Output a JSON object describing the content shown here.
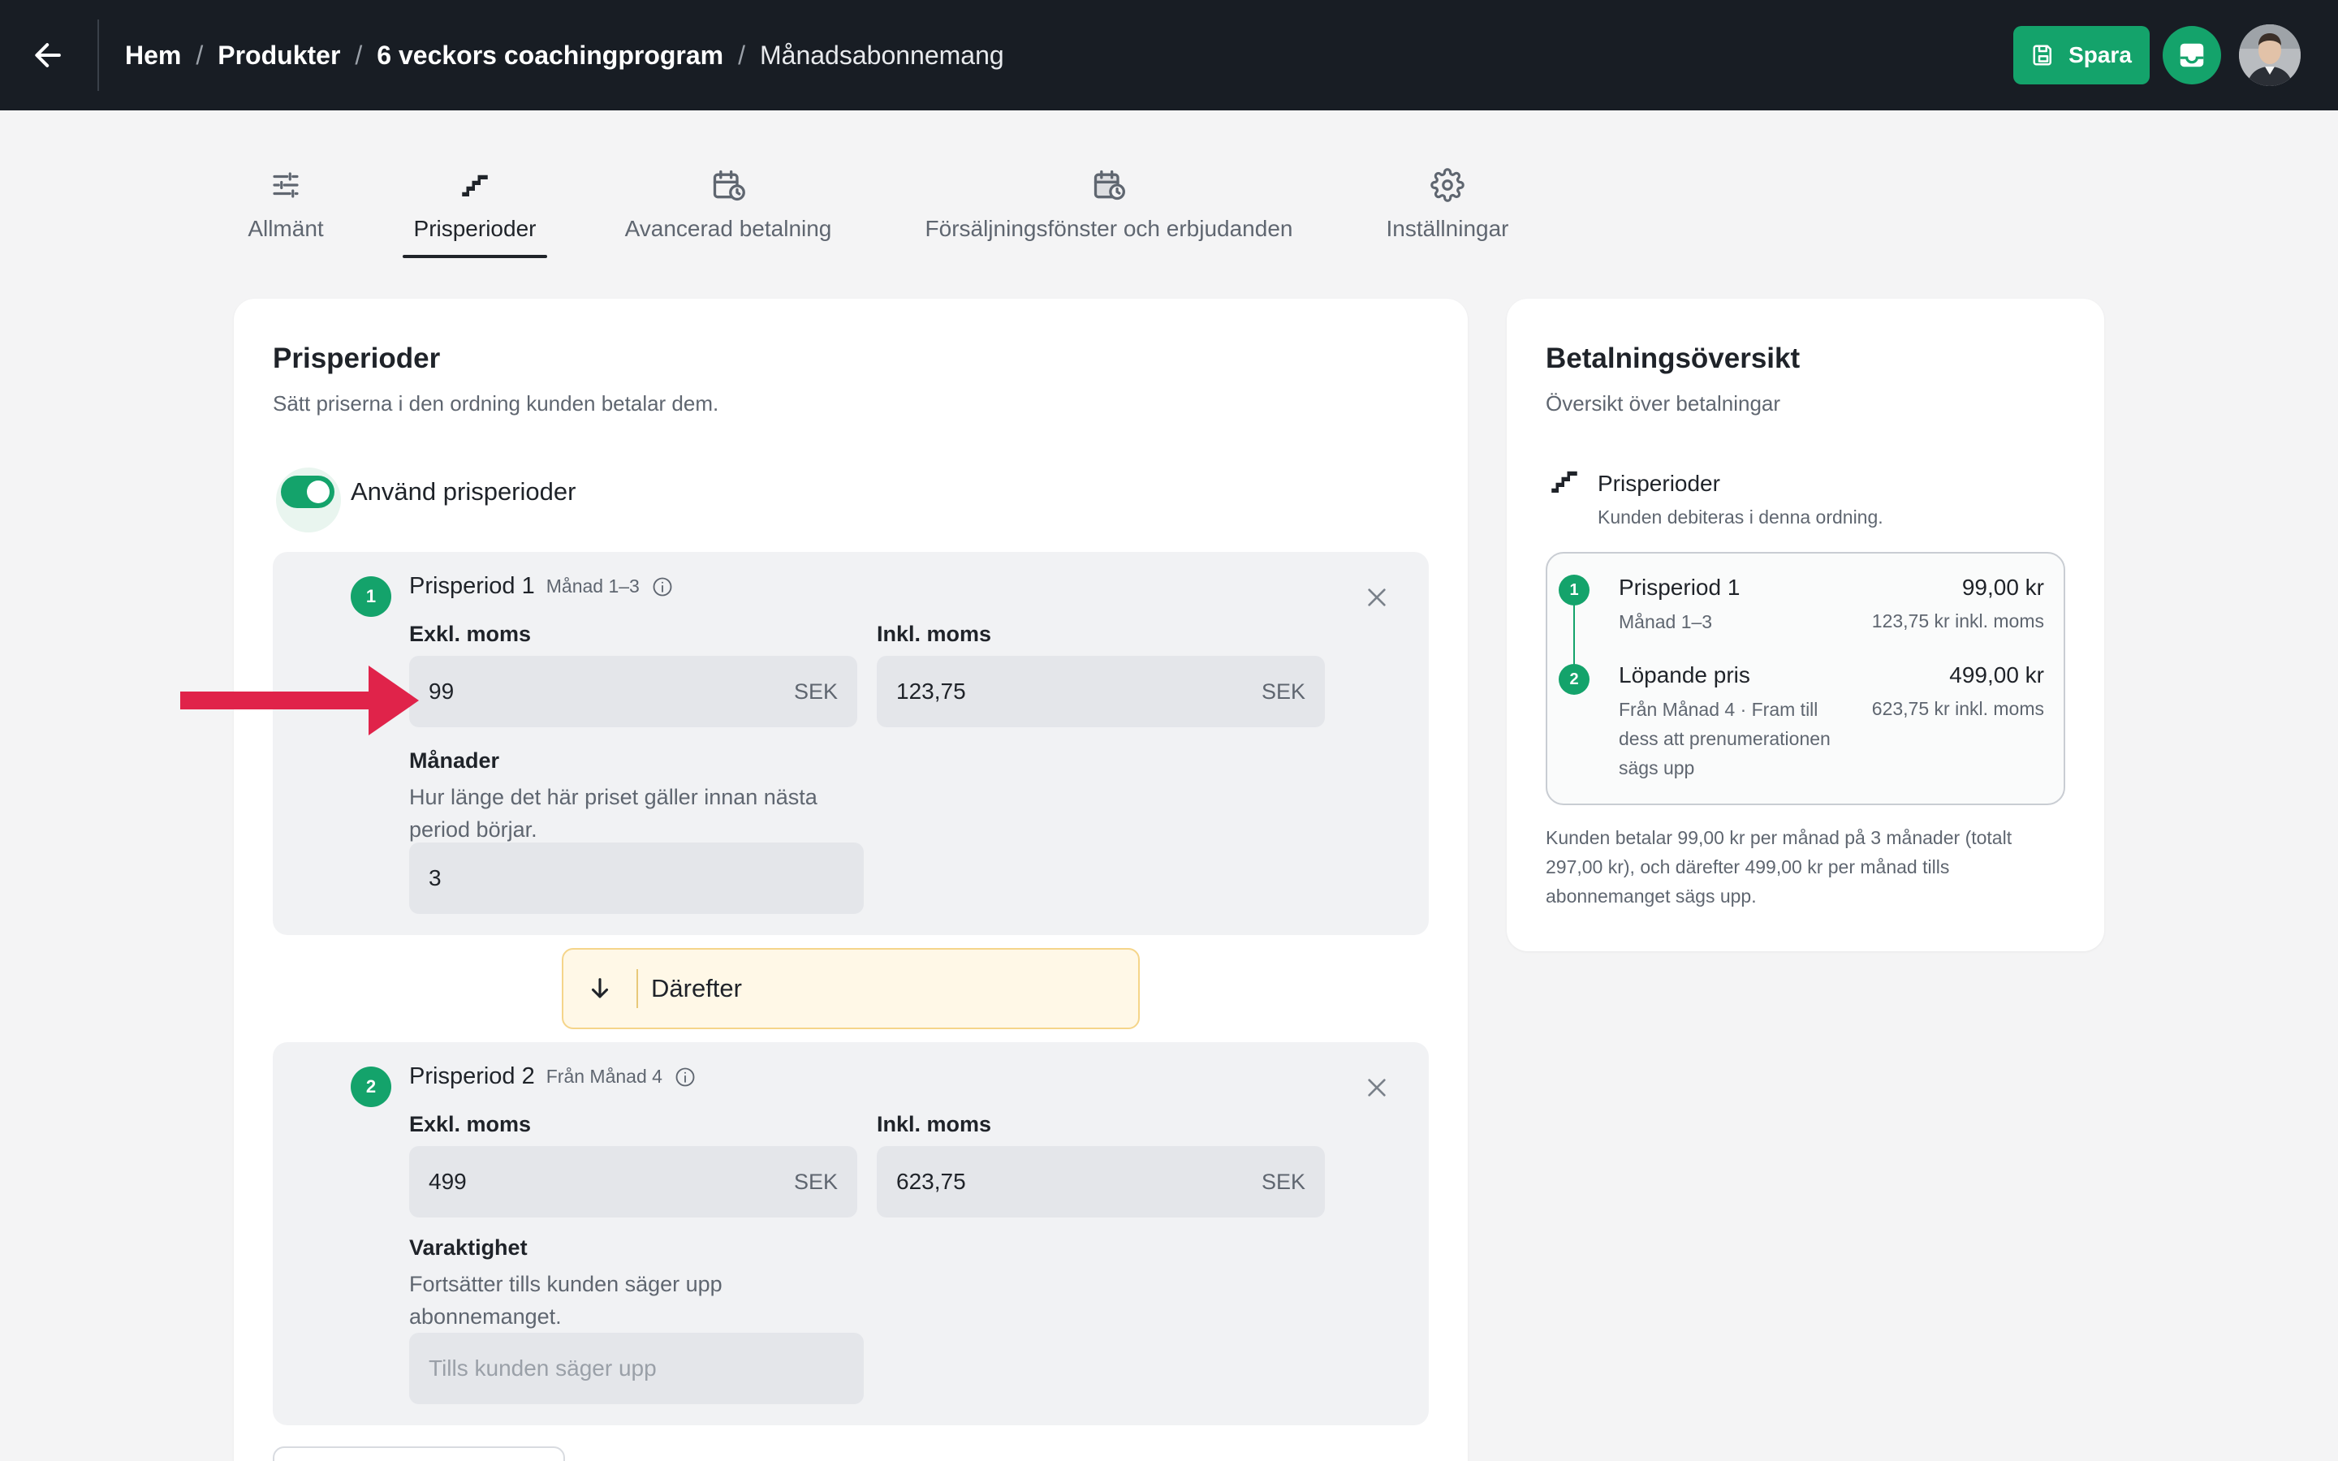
{
  "topbar": {
    "breadcrumb": [
      "Hem",
      "Produkter",
      "6 veckors coachingprogram"
    ],
    "breadcrumb_current": "Månadsabonnemang",
    "save_label": "Spara",
    "colors": {
      "bar": "#181d24",
      "accent": "#14a36b"
    }
  },
  "tabs": [
    {
      "label": "Allmänt",
      "icon": "sliders-icon"
    },
    {
      "label": "Prisperioder",
      "icon": "stairs-icon",
      "active": true
    },
    {
      "label": "Avancerad betalning",
      "icon": "calendar-clock-icon"
    },
    {
      "label": "Försäljningsfönster och erbjudanden",
      "icon": "calendar-clock-icon"
    },
    {
      "label": "Inställningar",
      "icon": "gear-icon"
    }
  ],
  "main": {
    "title": "Prisperioder",
    "subtitle": "Sätt priserna i den ordning kunden betalar dem.",
    "toggle_label": "Använd prisperioder",
    "toggle_on": true,
    "periods": [
      {
        "number": "1",
        "name": "Prisperiod 1",
        "range": "Månad 1–3",
        "excl_label": "Exkl. moms",
        "excl_value": "99",
        "incl_label": "Inkl. moms",
        "incl_value": "123,75",
        "currency": "SEK",
        "extra_label": "Månader",
        "extra_help": "Hur länge det här priset gäller innan nästa period börjar.",
        "extra_value": "3"
      },
      {
        "number": "2",
        "name": "Prisperiod 2",
        "range": "Från Månad 4",
        "excl_label": "Exkl. moms",
        "excl_value": "499",
        "incl_label": "Inkl. moms",
        "incl_value": "623,75",
        "currency": "SEK",
        "extra_label": "Varaktighet",
        "extra_help": "Fortsätter tills kunden säger upp abonnemanget.",
        "extra_placeholder": "Tills kunden säger upp"
      }
    ],
    "thereafter_label": "Därefter"
  },
  "side": {
    "title": "Betalningsöversikt",
    "subtitle": "Översikt över betalningar",
    "section_title": "Prisperioder",
    "section_sub": "Kunden debiteras i denna ordning.",
    "items": [
      {
        "number": "1",
        "title": "Prisperiod 1",
        "sub": "Månad 1–3",
        "price": "99,00 kr",
        "price_incl": "123,75 kr inkl. moms"
      },
      {
        "number": "2",
        "title": "Löpande pris",
        "sub": "Från Månad 4 · Fram till dess att prenumerationen sägs upp",
        "price": "499,00 kr",
        "price_incl": "623,75 kr inkl. moms"
      }
    ],
    "footer": "Kunden betalar 99,00 kr per månad på 3 månader (totalt 297,00 kr), och därefter 499,00 kr per månad tills abonnemanget sägs upp."
  }
}
